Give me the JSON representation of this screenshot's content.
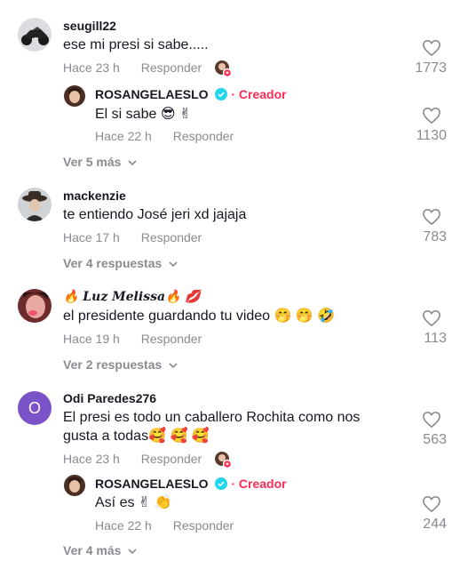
{
  "comments": [
    {
      "username": "seugill22",
      "text": "ese mi presi si sabe.....",
      "time": "Hace 23 h",
      "reply_label": "Responder",
      "likes": "1773",
      "reply": {
        "username": "ROSANGELAESLO",
        "badge": "Creador",
        "text": "El si sabe 😎 ✌",
        "time": "Hace 22 h",
        "reply_label": "Responder",
        "likes": "1130"
      },
      "more": "Ver 5 más"
    },
    {
      "username": "mackenzie",
      "text": "te entiendo José jeri xd jajaja",
      "time": "Hace 17 h",
      "reply_label": "Responder",
      "likes": "783",
      "more": "Ver 4 respuestas"
    },
    {
      "username": "🔥 Luz Melissa🔥 💋",
      "text": "el presidente guardando tu video 🤭 🤭 🤣",
      "time": "Hace 19 h",
      "reply_label": "Responder",
      "likes": "113",
      "more": "Ver 2 respuestas"
    },
    {
      "username": "Odi Paredes276",
      "avatar_letter": "O",
      "text": "El presi es todo un caballero Rochita como nos gusta a todas🥰 🥰 🥰",
      "time": "Hace 23 h",
      "reply_label": "Responder",
      "likes": "563",
      "reply": {
        "username": "ROSANGELAESLO",
        "badge": "Creador",
        "text": "Así es ✌ 👏",
        "time": "Hace 22 h",
        "reply_label": "Responder",
        "likes": "244"
      },
      "more": "Ver 4 más"
    }
  ],
  "colors": {
    "accent": "#fe2c55",
    "verified": "#20d5ec",
    "muted": "#8a8b91",
    "avatar_purple": "#7b53c8"
  }
}
